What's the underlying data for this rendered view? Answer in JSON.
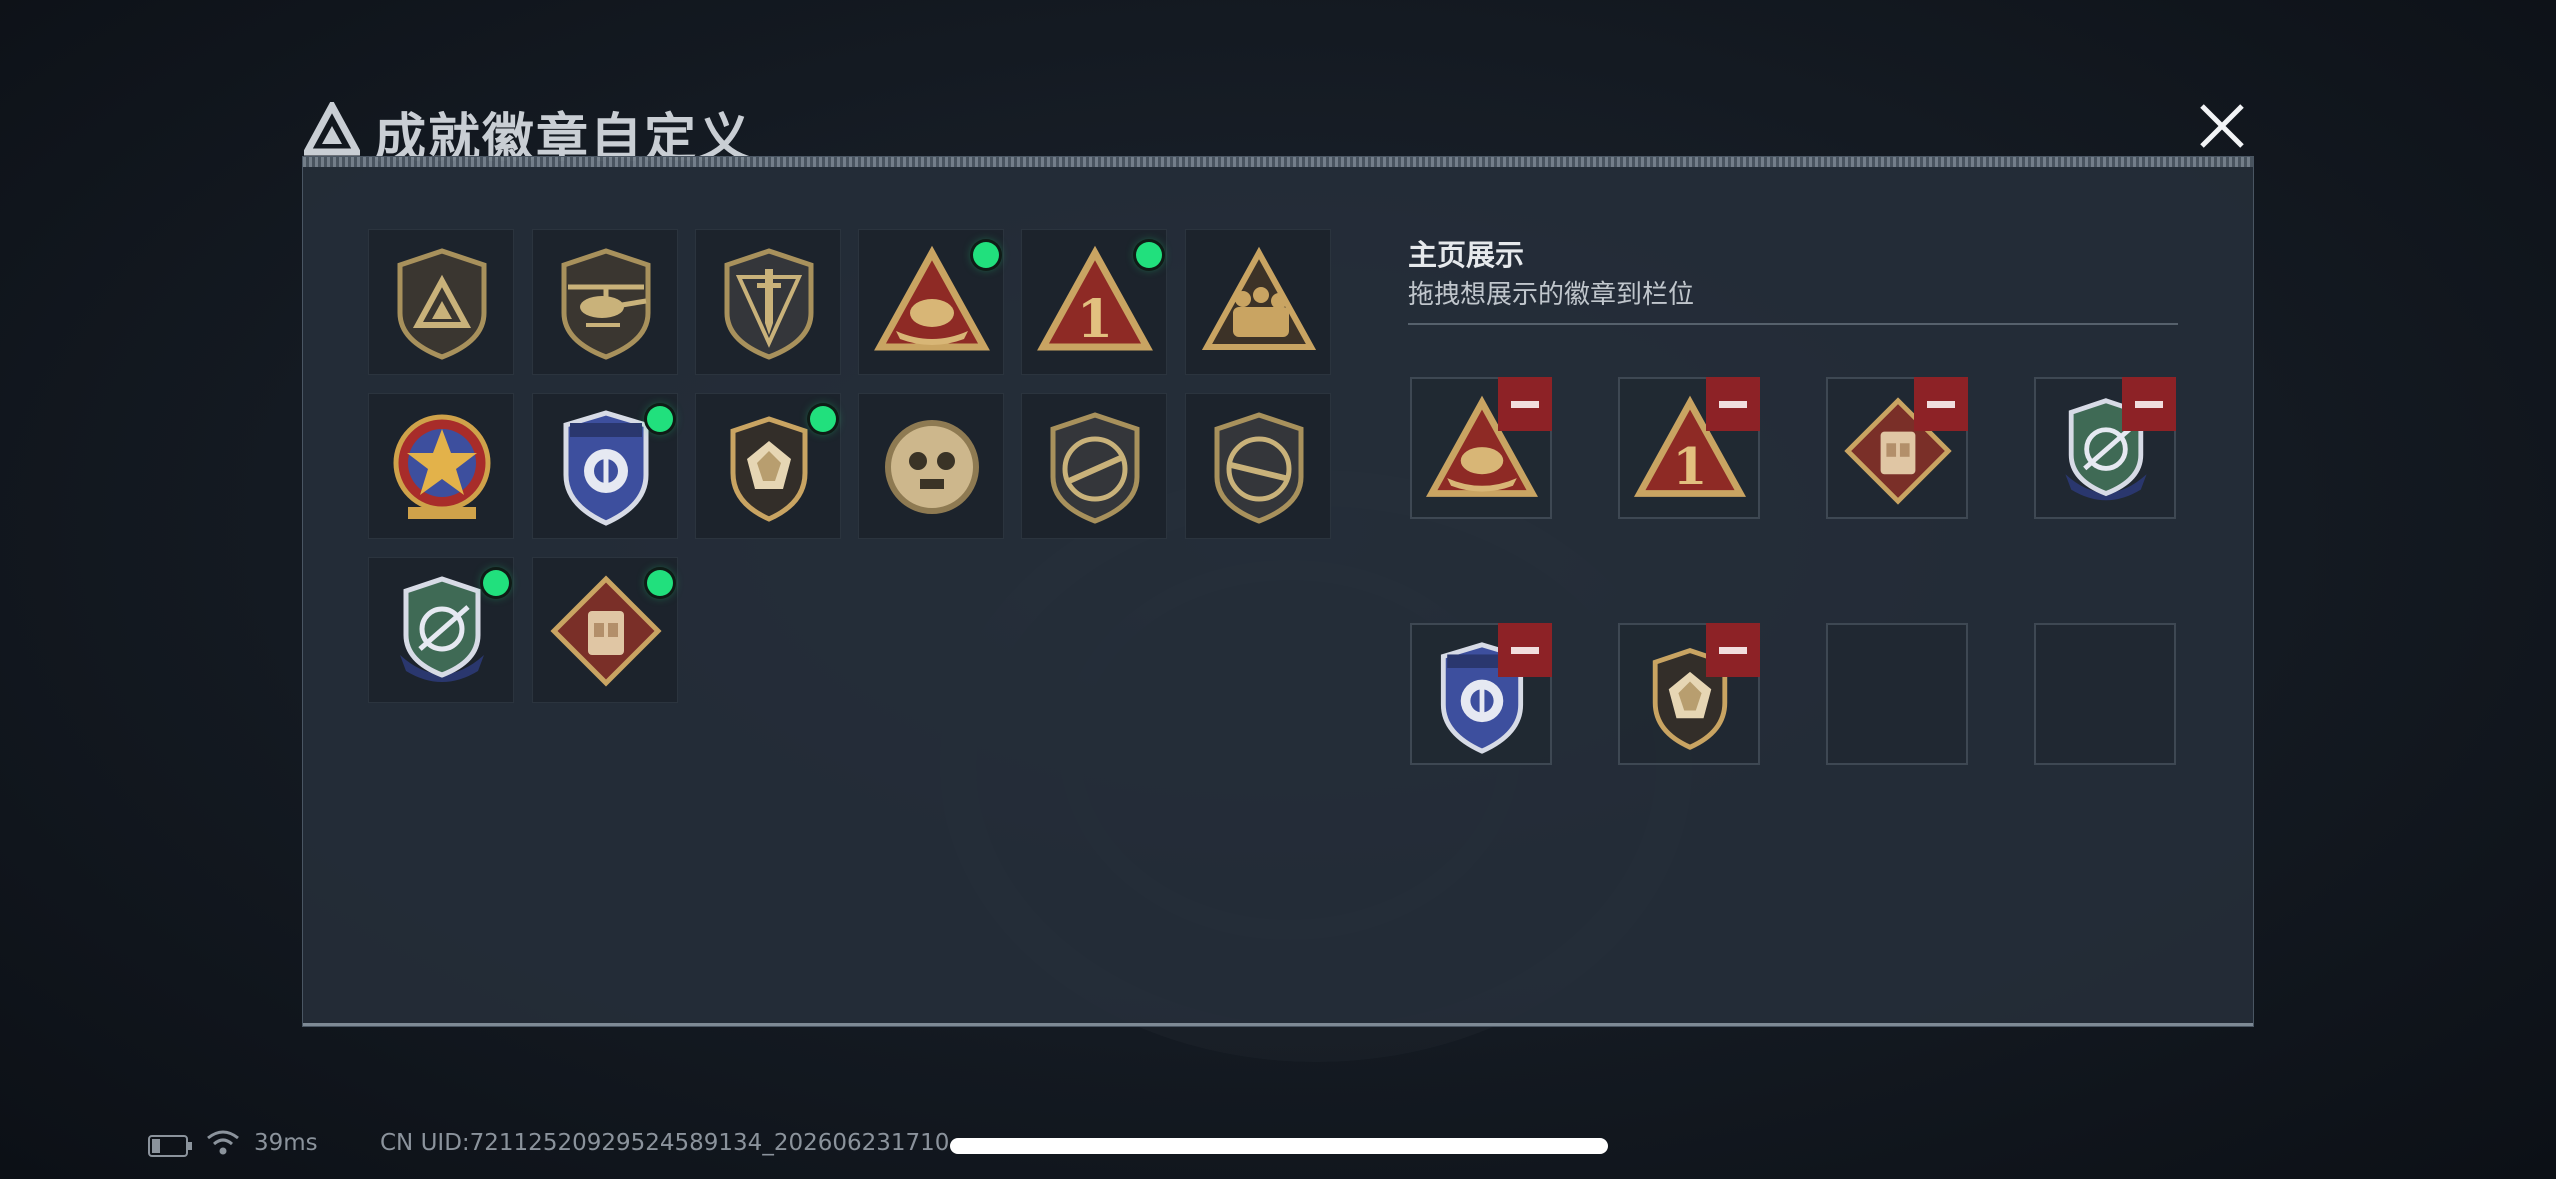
{
  "dialog": {
    "tiny_header": "",
    "title": "成就徽章自定义",
    "close_icon": "close-icon"
  },
  "colors": {
    "new_dot": "#21e07d",
    "remove_button": "#8d2226",
    "gold": "#c9a462",
    "red": "#8e2a25",
    "navy": "#3d4f9e"
  },
  "showcase": {
    "title": "主页展示",
    "subtitle": "拖拽想展示的徽章到栏位"
  },
  "inventory": [
    {
      "icon": "triangle-shield-badge",
      "new": false
    },
    {
      "icon": "helicopter-badge",
      "new": false
    },
    {
      "icon": "dagger-shield-badge",
      "new": false
    },
    {
      "icon": "hands-triangle-badge",
      "new": true
    },
    {
      "icon": "number-one-triangle-badge",
      "new": true
    },
    {
      "icon": "soldiers-triangle-badge",
      "new": false
    },
    {
      "icon": "star-medal-badge",
      "new": false
    },
    {
      "icon": "blue-shield-badge",
      "new": true
    },
    {
      "icon": "fist-shield-badge",
      "new": true
    },
    {
      "icon": "skull-round-badge",
      "new": false
    },
    {
      "icon": "rifle-shield-badge",
      "new": false
    },
    {
      "icon": "rifle-shield-badge-2",
      "new": false
    },
    {
      "icon": "green-crest-badge",
      "new": true
    },
    {
      "icon": "vest-diamond-badge",
      "new": true
    }
  ],
  "display_slots": [
    {
      "icon": "hands-triangle-badge",
      "filled": true
    },
    {
      "icon": "number-one-triangle-badge",
      "filled": true
    },
    {
      "icon": "vest-diamond-badge",
      "filled": true
    },
    {
      "icon": "green-crest-badge",
      "filled": true
    },
    {
      "icon": "blue-shield-badge",
      "filled": true
    },
    {
      "icon": "fist-shield-badge",
      "filled": true
    },
    {
      "icon": "",
      "filled": false
    },
    {
      "icon": "",
      "filled": false
    }
  ],
  "status_bar": {
    "ping": "39ms",
    "uid": "CN UID:72112520929524589134_202606231710"
  },
  "badge_text": {
    "one": "1"
  }
}
